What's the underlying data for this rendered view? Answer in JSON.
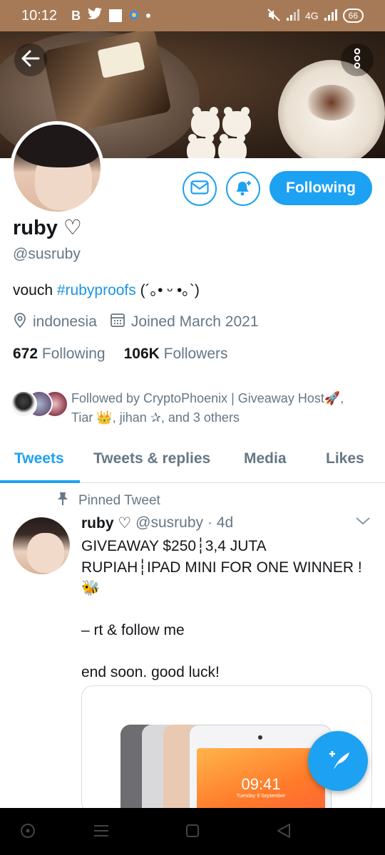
{
  "status_bar": {
    "time": "10:12",
    "notif_letter": "B",
    "network": "4G",
    "battery": "66"
  },
  "profile": {
    "display_name": "ruby ♡",
    "handle": "@susruby",
    "bio_prefix": "vouch ",
    "bio_hashtag": "#rubyproofs",
    "bio_suffix": " (´｡• ᵕ •｡`)",
    "location": "indonesia",
    "joined": "Joined March 2021",
    "following_count": "672",
    "following_label": "Following",
    "followers_count": "106K",
    "followers_label": "Followers",
    "followed_by_line1": "Followed by CryptoPhoenix | Giveaway Host🚀,",
    "followed_by_line2": "Tiar 👑, jihan ✰, and 3 others"
  },
  "actions": {
    "following_button": "Following"
  },
  "tabs": [
    {
      "label": "Tweets",
      "active": true
    },
    {
      "label": "Tweets & replies",
      "active": false
    },
    {
      "label": "Media",
      "active": false
    },
    {
      "label": "Likes",
      "active": false
    }
  ],
  "pinned_tweet": {
    "pinned_label": "Pinned Tweet",
    "author_name": "ruby ♡",
    "author_handle": "@susruby",
    "time": "· 4d",
    "line1": "GIVEAWAY $250┆3,4 JUTA",
    "line2": "RUPIAH┆IPAD MINI FOR ONE WINNER !",
    "line3": "🐝",
    "line4": "– rt & follow me",
    "line5": "end soon. good luck!",
    "media_time": "09:41",
    "media_date": "Tuesday 9 September"
  },
  "icons": {
    "back": "arrow-left-icon",
    "more": "more-vertical-icon",
    "mail": "mail-icon",
    "notify": "bell-plus-icon",
    "location": "location-pin-icon",
    "calendar": "calendar-icon",
    "pin": "pin-icon",
    "caret": "chevron-down-icon",
    "compose": "compose-feather-icon"
  },
  "colors": {
    "accent": "#1da1f2",
    "status_bar": "#a77a57",
    "secondary_text": "#657786"
  }
}
